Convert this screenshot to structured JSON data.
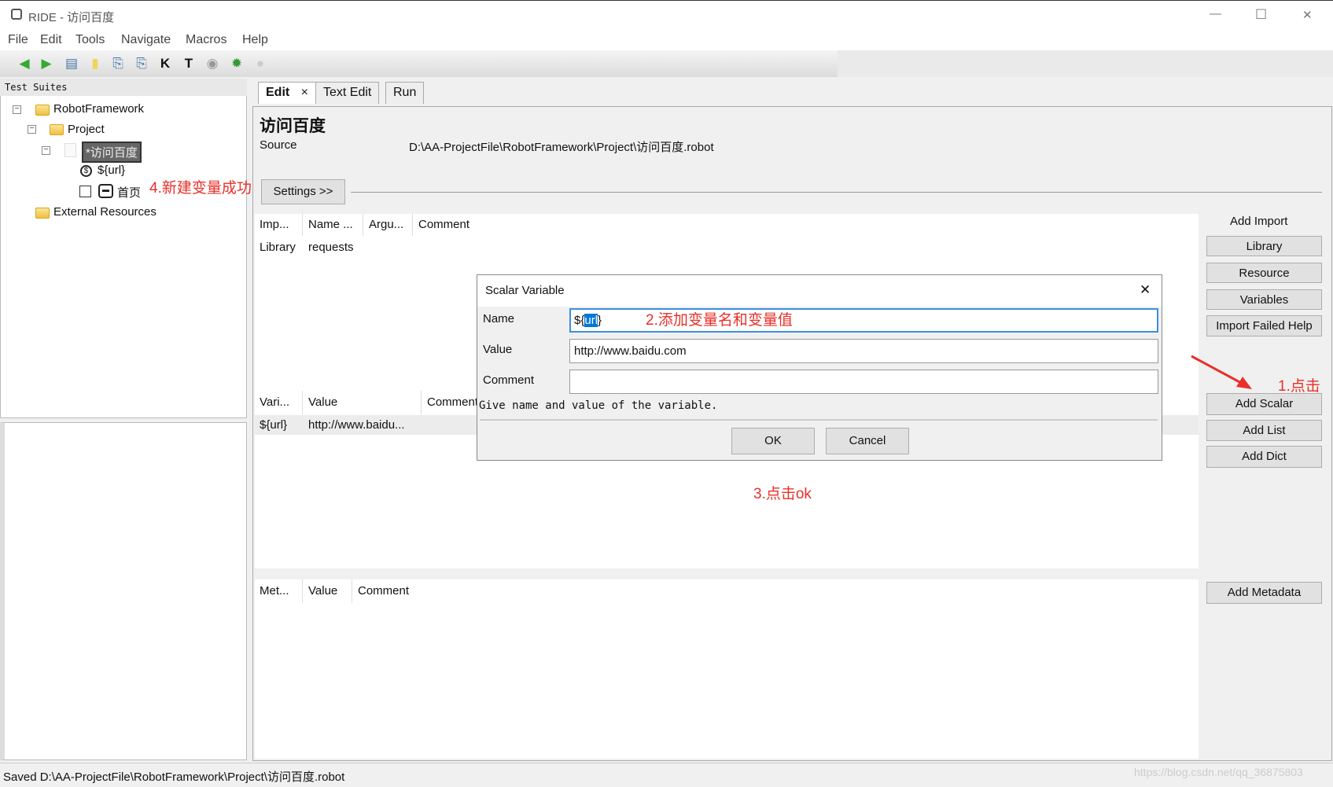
{
  "window": {
    "title": "RIDE - 访问百度",
    "minimize": "—",
    "maximize": "☐",
    "close": "✕"
  },
  "menu": [
    "File",
    "Edit",
    "Tools",
    "Navigate",
    "Macros",
    "Help"
  ],
  "toolbar": {
    "icons": [
      "back-arrow-icon",
      "forward-arrow-icon",
      "open-suite-icon",
      "open-directory-icon",
      "save-icon",
      "save-all-icon",
      "search-keywords-icon",
      "search-tests-icon",
      "run-icon",
      "debug-bug-icon",
      "stop-icon"
    ]
  },
  "tree": {
    "header": "Test Suites",
    "items": [
      {
        "label": "RobotFramework"
      },
      {
        "label": "Project"
      },
      {
        "label": "*访问百度"
      },
      {
        "label": "${url}"
      },
      {
        "label": "首页"
      },
      {
        "label": "External Resources"
      }
    ]
  },
  "tabs": [
    {
      "label": "Edit",
      "close": "×"
    },
    {
      "label": "Text Edit"
    },
    {
      "label": "Run"
    }
  ],
  "editor": {
    "title": "访问百度",
    "source_label": "Source",
    "source_value": "D:\\AA-ProjectFile\\RobotFramework\\Project\\访问百度.robot",
    "settings_button": "Settings >>",
    "imports": {
      "headers": [
        "Imp...",
        "Name ...",
        "Argu...",
        "Comment"
      ],
      "rows": [
        [
          "Library",
          "requests",
          "",
          ""
        ]
      ]
    },
    "variables": {
      "headers": [
        "Vari...",
        "Value",
        "Comment"
      ],
      "rows": [
        [
          "${url}",
          "http://www.baidu...",
          ""
        ]
      ]
    },
    "metadata": {
      "headers": [
        "Met...",
        "Value",
        "Comment"
      ]
    }
  },
  "side_buttons": {
    "add_import_label": "Add Import",
    "library": "Library",
    "resource": "Resource",
    "variables": "Variables",
    "import_failed_help": "Import Failed Help",
    "add_scalar": "Add Scalar",
    "add_list": "Add List",
    "add_dict": "Add Dict",
    "add_metadata": "Add Metadata"
  },
  "dialog": {
    "title": "Scalar Variable",
    "close": "✕",
    "name_label": "Name",
    "name_prefix": "${",
    "name_selected": "url",
    "name_suffix": "}",
    "value_label": "Value",
    "value": "http://www.baidu.com",
    "comment_label": "Comment",
    "comment": "",
    "help": "Give name and value of the variable.",
    "ok": "OK",
    "cancel": "Cancel"
  },
  "annotations": {
    "step1": "1.点击",
    "step2": "2.添加变量名和变量值",
    "step3": "3.点击ok",
    "step4": "4.新建变量成功",
    "color": "#e8302a"
  },
  "status": "Saved D:\\AA-ProjectFile\\RobotFramework\\Project\\访问百度.robot",
  "watermark": "https://blog.csdn.net/qq_36875803"
}
